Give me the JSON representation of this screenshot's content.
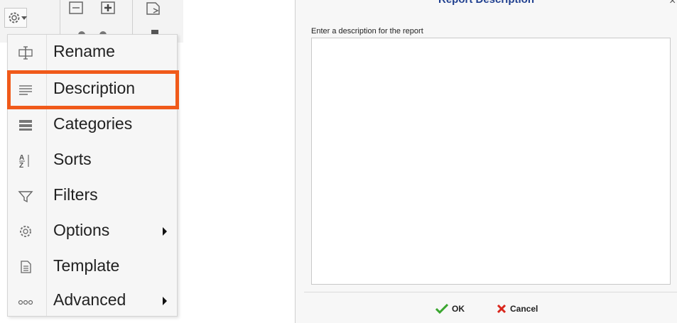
{
  "menu": {
    "items": [
      {
        "label": "Rename",
        "icon": "rename-icon",
        "submenu": false
      },
      {
        "label": "Description",
        "icon": "description-icon",
        "submenu": false,
        "highlighted": true
      },
      {
        "label": "Categories",
        "icon": "categories-icon",
        "submenu": false
      },
      {
        "label": "Sorts",
        "icon": "sort-az-icon",
        "submenu": false
      },
      {
        "label": "Filters",
        "icon": "filter-icon",
        "submenu": false
      },
      {
        "label": "Options",
        "icon": "gear-icon",
        "submenu": true
      },
      {
        "label": "Template",
        "icon": "template-icon",
        "submenu": false
      },
      {
        "label": "Advanced",
        "icon": "more-icon",
        "submenu": true
      }
    ]
  },
  "dialog": {
    "title": "Report Description",
    "prompt": "Enter a description for the report",
    "description_value": "",
    "ok_label": "OK",
    "cancel_label": "Cancel"
  },
  "colors": {
    "highlight": "#f05a1a",
    "title": "#1f3f8f",
    "ok_green": "#3aa62f",
    "cancel_red": "#d9261c"
  }
}
